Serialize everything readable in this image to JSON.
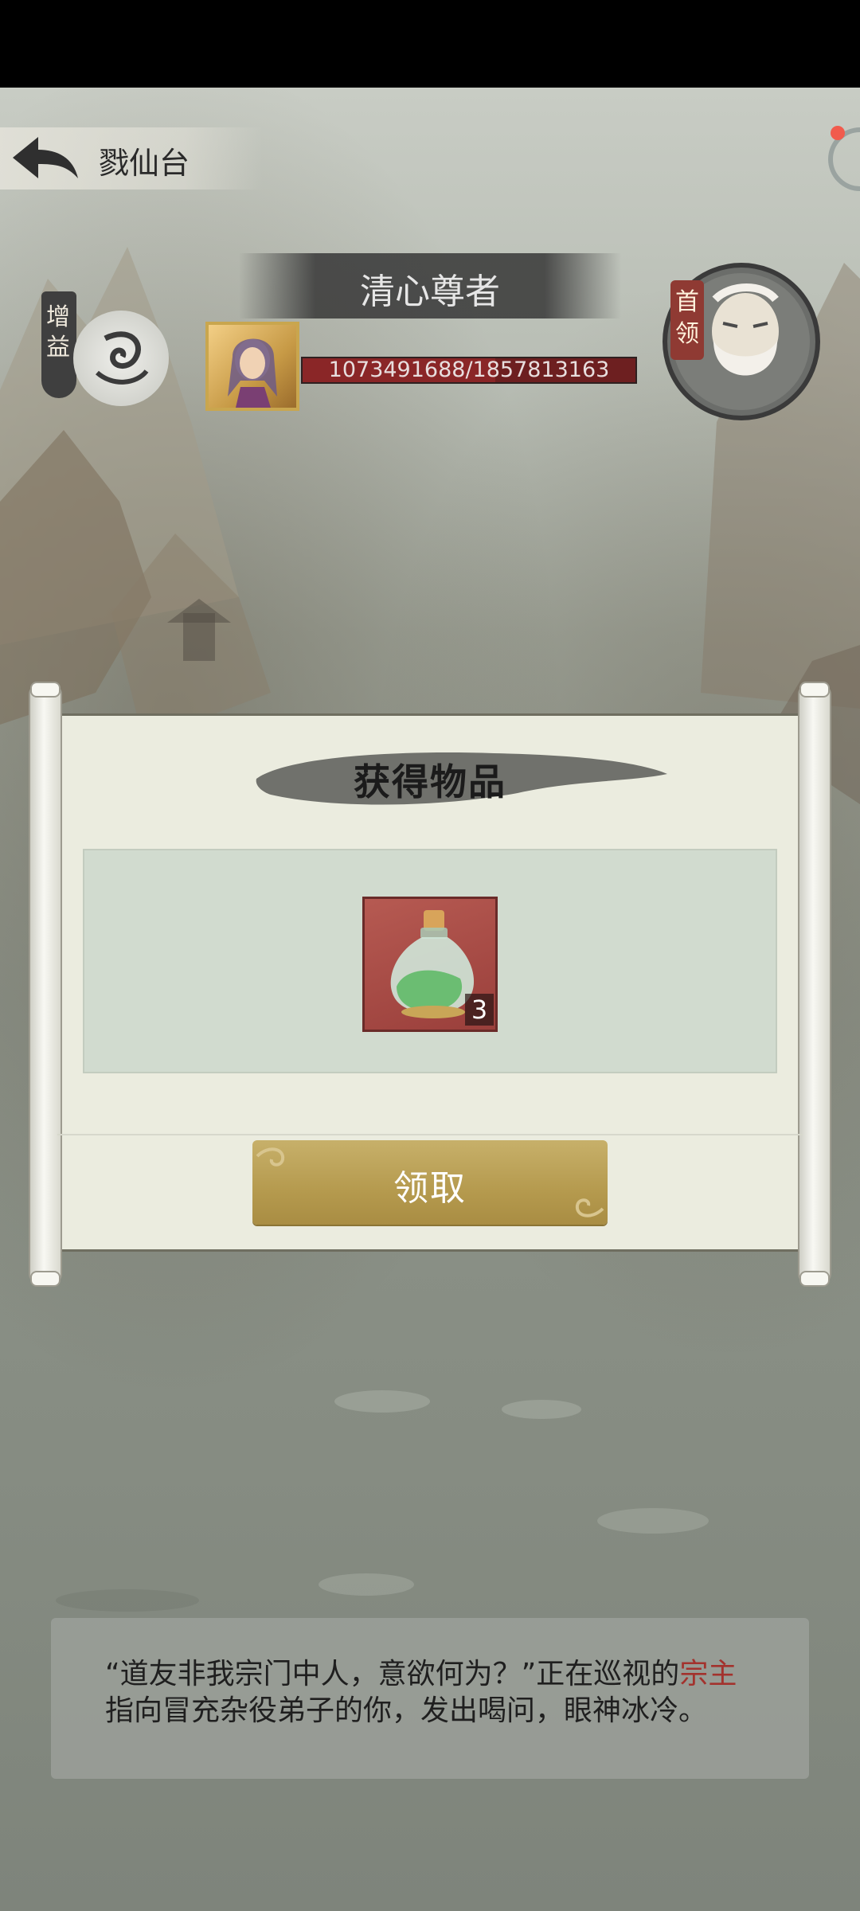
{
  "header": {
    "page_title": "戮仙台"
  },
  "boss": {
    "name": "清心尊者",
    "hp_text": "1073491688/1857813163",
    "hp_current": 1073491688,
    "hp_max": 1857813163,
    "boost_label": "增益",
    "leader_badge": "首领"
  },
  "reward_dialog": {
    "title": "获得物品",
    "items": [
      {
        "icon": "potion-bottle-icon",
        "count": "3"
      }
    ],
    "claim_label": "领取"
  },
  "narrative": {
    "before": "“道友非我宗门中人，意欲何为？”正在巡视的",
    "highlight": "宗主",
    "after": "指向冒充杂役弟子的你，发出喝问，眼神冰冷。"
  },
  "colors": {
    "highlight": "#a3322d",
    "hp_bar": "#6d1f20",
    "claim_button": "#b59a4e"
  }
}
